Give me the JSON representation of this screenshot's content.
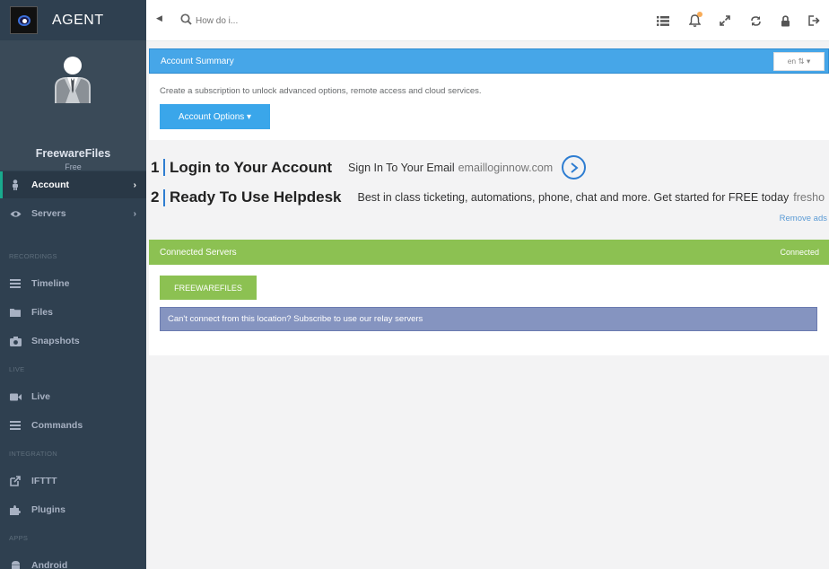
{
  "brand": {
    "name": "AGENT"
  },
  "profile": {
    "name": "FreewareFiles",
    "plan": "Free"
  },
  "nav": {
    "account": "Account",
    "servers": "Servers",
    "section_recordings": "RECORDINGS",
    "timeline": "Timeline",
    "files": "Files",
    "snapshots": "Snapshots",
    "section_live": "LIVE",
    "live": "Live",
    "commands": "Commands",
    "section_integration": "INTEGRATION",
    "ifttt": "IFTTT",
    "plugins": "Plugins",
    "section_apps": "APPS",
    "android": "Android"
  },
  "search": {
    "placeholder": "How do i..."
  },
  "account_summary": {
    "title": "Account Summary",
    "language": "en ⇅ ▾",
    "subscribe_text": "Create a subscription to unlock advanced options, remote access and cloud services.",
    "options_button": "Account Options ▾"
  },
  "ads": [
    {
      "num": "1",
      "title": "Login to Your Account",
      "desc": "Sign In To Your Email",
      "url": "emailloginnow.com"
    },
    {
      "num": "2",
      "title": "Ready To Use Helpdesk",
      "desc": "Best in class ticketing, automations, phone, chat and more. Get started for FREE today",
      "url": "fresho"
    }
  ],
  "remove_ads": "Remove ads",
  "connected_servers": {
    "title": "Connected Servers",
    "status": "Connected",
    "server_button": "FREEWAREFILES",
    "relay_alert": "Can't connect from this location? Subscribe to use our relay servers"
  },
  "colors": {
    "sidebar": "#2f4050",
    "accent_blue": "#46a6e8",
    "accent_green": "#8cc152",
    "alert": "#8594c0"
  }
}
